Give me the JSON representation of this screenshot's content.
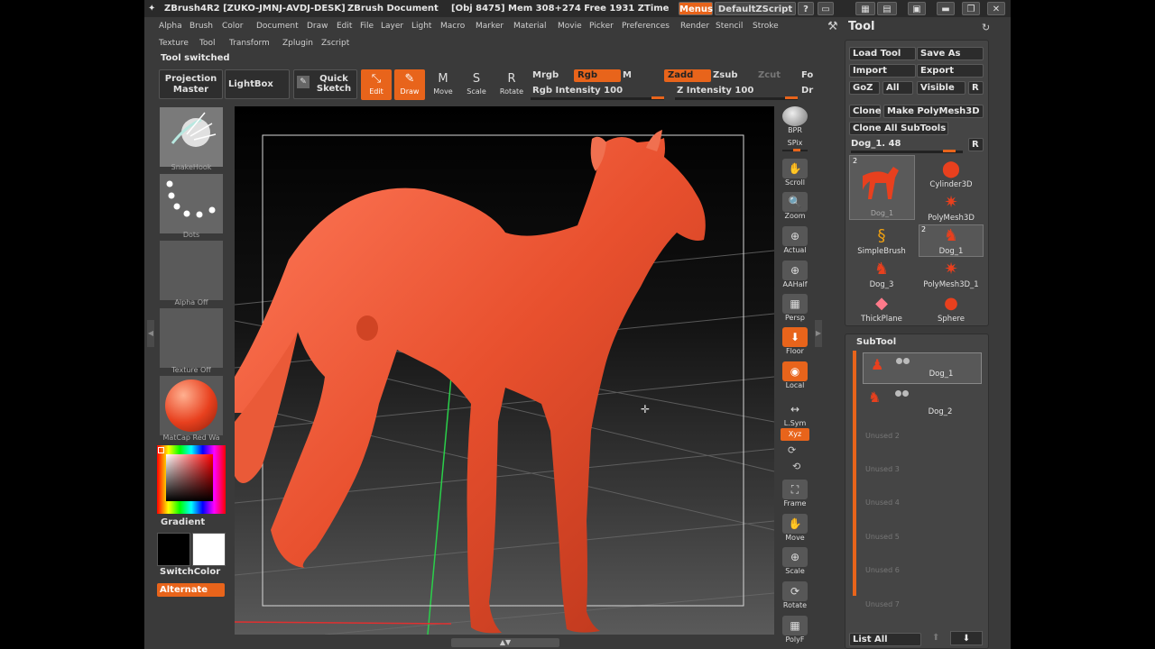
{
  "title_bar": {
    "app": "ZBrush4R2 [ZUKO-JMNJ-AVDJ-DESK]",
    "document": "ZBrush Document",
    "stats": "[Obj 8475] Mem 308+274 Free 1931 ZTime",
    "menus_label": "Menus",
    "script_label": "DefaultZScript"
  },
  "menubar": {
    "row1": [
      "Alpha",
      "Brush",
      "Color",
      "Document",
      "Draw",
      "Edit",
      "File",
      "Layer",
      "Light",
      "Macro",
      "Marker",
      "Material",
      "Movie",
      "Picker",
      "Preferences",
      "Render",
      "Stencil",
      "Stroke"
    ],
    "row2": [
      "Texture",
      "Tool",
      "Transform",
      "Zplugin",
      "Zscript"
    ]
  },
  "status_text": "Tool switched",
  "top_shelf": {
    "projection_master": "Projection Master",
    "lightbox": "LightBox",
    "quick_sketch": "Quick Sketch",
    "edit": "Edit",
    "draw": "Draw",
    "move": "Move",
    "scale": "Scale",
    "rotate": "Rotate",
    "move_key": "M",
    "scale_key": "S",
    "rotate_key": "R",
    "mrgb": "Mrgb",
    "rgb": "Rgb",
    "m": "M",
    "zadd": "Zadd",
    "zsub": "Zsub",
    "zcut": "Zcut",
    "fo": "Fo",
    "rgb_intensity": "Rgb Intensity 100",
    "z_intensity": "Z Intensity 100",
    "dr": "Dr"
  },
  "left_shelf": {
    "brush": "SnakeHook",
    "stroke": "Dots",
    "alpha": "Alpha Off",
    "texture": "Texture Off",
    "material": "MatCap Red Wa",
    "gradient": "Gradient",
    "switch_color": "SwitchColor",
    "alternate": "Alternate"
  },
  "right_shelf": {
    "items": [
      {
        "label": "BPR"
      },
      {
        "label": "SPix"
      },
      {
        "label": "Scroll"
      },
      {
        "label": "Zoom"
      },
      {
        "label": "Actual"
      },
      {
        "label": "AAHalf"
      },
      {
        "label": "Persp"
      },
      {
        "label": "Floor"
      },
      {
        "label": "Local"
      },
      {
        "label": "L.Sym"
      },
      {
        "label": "Xyz"
      },
      {
        "label": "Frame"
      },
      {
        "label": "Move"
      },
      {
        "label": "Scale"
      },
      {
        "label": "Rotate"
      },
      {
        "label": "PolyF"
      }
    ]
  },
  "tool_panel": {
    "title": "Tool",
    "load_tool": "Load Tool",
    "save_as": "Save As",
    "import": "Import",
    "export": "Export",
    "goz": "GoZ",
    "all": "All",
    "visible": "Visible",
    "r": "R",
    "clone": "Clone",
    "make_polymesh": "Make PolyMesh3D",
    "clone_all": "Clone All SubTools",
    "slider_label": "Dog_1. 48",
    "selected_tool": "Dog_1",
    "selected_badge": "2",
    "dog1_badge": "2",
    "tools": [
      "Cylinder3D",
      "PolyMesh3D",
      "SimpleBrush",
      "Dog_1",
      "Dog_3",
      "PolyMesh3D_1",
      "ThickPlane",
      "Sphere"
    ]
  },
  "subtool": {
    "title": "SubTool",
    "items": [
      "Dog_1",
      "Dog_2"
    ],
    "unused": [
      "Unused 2",
      "Unused 3",
      "Unused 4",
      "Unused 5",
      "Unused 6",
      "Unused 7"
    ],
    "list_all": "List All"
  }
}
